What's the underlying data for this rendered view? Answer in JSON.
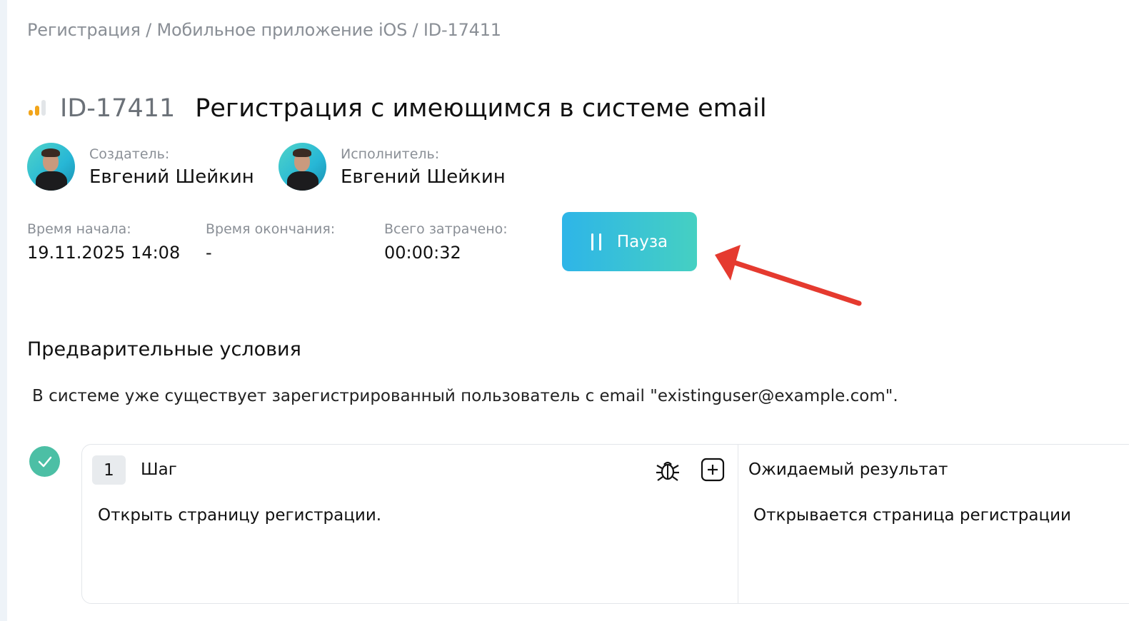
{
  "breadcrumb": "Регистрация / Мобильное приложение iOS / ID-17411",
  "task": {
    "id": "ID-17411",
    "title": "Регистрация с имеющимся в системе email",
    "priority_icon": "priority-bars-icon"
  },
  "creator": {
    "label": "Создатель:",
    "name": "Евгений Шейкин"
  },
  "assignee": {
    "label": "Исполнитель:",
    "name": "Евгений Шейкин"
  },
  "times": {
    "start_label": "Время начала:",
    "start_value": "19.11.2025 14:08",
    "end_label": "Время окончания:",
    "end_value": "-",
    "total_label": "Всего затрачено:",
    "total_value": "00:00:32"
  },
  "pause_button": {
    "label": "Пауза",
    "icon": "pause-icon"
  },
  "preconditions": {
    "title": "Предварительные условия",
    "text": "В системе уже существует зарегистрированный пользователь с email \"existinguser@example.com\"."
  },
  "steps": [
    {
      "number": "1",
      "label": "Шаг",
      "text": "Открыть страницу регистрации.",
      "expected_label": "Ожидаемый результат",
      "expected_text": "Открывается страница регистрации",
      "status": "passed"
    }
  ],
  "colors": {
    "accent_gradient_start": "#2eb5e8",
    "accent_gradient_end": "#45d0c2",
    "check": "#4cbfa5",
    "priority": "#f2a51a",
    "annotation_arrow": "#e53a2f"
  }
}
